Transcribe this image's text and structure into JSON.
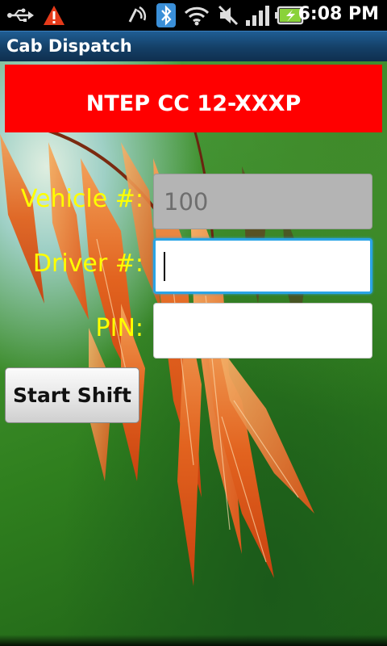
{
  "status_bar": {
    "time": "6:08 PM",
    "icons": [
      "usb-icon",
      "warning-icon",
      "nfc-icon",
      "bluetooth-icon",
      "wifi-icon",
      "mute-icon",
      "signal-icon",
      "battery-charging-icon"
    ]
  },
  "app": {
    "title": "Cab Dispatch"
  },
  "banner": {
    "text": "NTEP CC 12-XXXP",
    "color": "#ff0000"
  },
  "form": {
    "vehicle": {
      "label": "Vehicle #:",
      "value": "100"
    },
    "driver": {
      "label": "Driver #:",
      "value": ""
    },
    "pin": {
      "label": "PIN:",
      "value": ""
    }
  },
  "actions": {
    "start_shift": "Start Shift"
  },
  "colors": {
    "label": "#ffff00",
    "focus": "#2aa4e6",
    "titlebar": "#1b4f7e"
  }
}
